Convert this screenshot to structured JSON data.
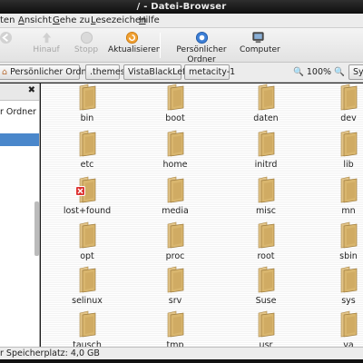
{
  "window": {
    "title": "/ - Datei-Browser"
  },
  "menu": [
    {
      "label": "ten",
      "underline": ""
    },
    {
      "label": "Ansicht",
      "underline": "A",
      "rest": "nsicht"
    },
    {
      "label": "Gehe zu",
      "underline": "G",
      "rest": "ehe zu"
    },
    {
      "label": "Lesezeichen",
      "underline": "L",
      "rest": "esezeichen"
    },
    {
      "label": "Hilfe",
      "underline": "H",
      "rest": "ilfe"
    }
  ],
  "toolbar": {
    "hinauf": "Hinauf",
    "stopp": "Stopp",
    "aktualisieren": "Aktualisieren",
    "home": "Persönlicher Ordner",
    "computer": "Computer"
  },
  "location": {
    "crumbs": [
      "Persönlicher Ordner",
      ".themes",
      "VistaBlackLeft",
      "metacity-1"
    ],
    "zoom": "100%",
    "right_button": "Sy"
  },
  "sidebar": {
    "items": [
      {
        "label": "r Ordner",
        "selected": false
      },
      {
        "label": "",
        "selected": true
      }
    ]
  },
  "files": [
    {
      "name": "bin"
    },
    {
      "name": "boot"
    },
    {
      "name": "daten"
    },
    {
      "name": "dev"
    },
    {
      "name": "etc"
    },
    {
      "name": "home"
    },
    {
      "name": "initrd"
    },
    {
      "name": "lib"
    },
    {
      "name": "lost+found",
      "locked": true
    },
    {
      "name": "media"
    },
    {
      "name": "misc"
    },
    {
      "name": "mn"
    },
    {
      "name": "opt"
    },
    {
      "name": "proc"
    },
    {
      "name": "root"
    },
    {
      "name": "sbin"
    },
    {
      "name": "selinux"
    },
    {
      "name": "srv"
    },
    {
      "name": "Suse"
    },
    {
      "name": "sys"
    },
    {
      "name": "tausch"
    },
    {
      "name": "tmp"
    },
    {
      "name": "usr"
    },
    {
      "name": "va"
    }
  ],
  "status": {
    "text": "r Speicherplatz: 4,0 GB"
  },
  "colors": {
    "selection": "#4a87cb",
    "folder": "#d4b26a",
    "titlebar": "#111111"
  },
  "icons": {
    "back": "back-arrow-icon",
    "up": "up-arrow-icon",
    "stop": "stop-icon",
    "reload": "reload-icon",
    "home": "home-icon",
    "computer": "computer-icon",
    "folder": "folder-icon",
    "zoom": "zoom-icon",
    "close": "close-icon",
    "lock": "lock-badge-icon"
  }
}
